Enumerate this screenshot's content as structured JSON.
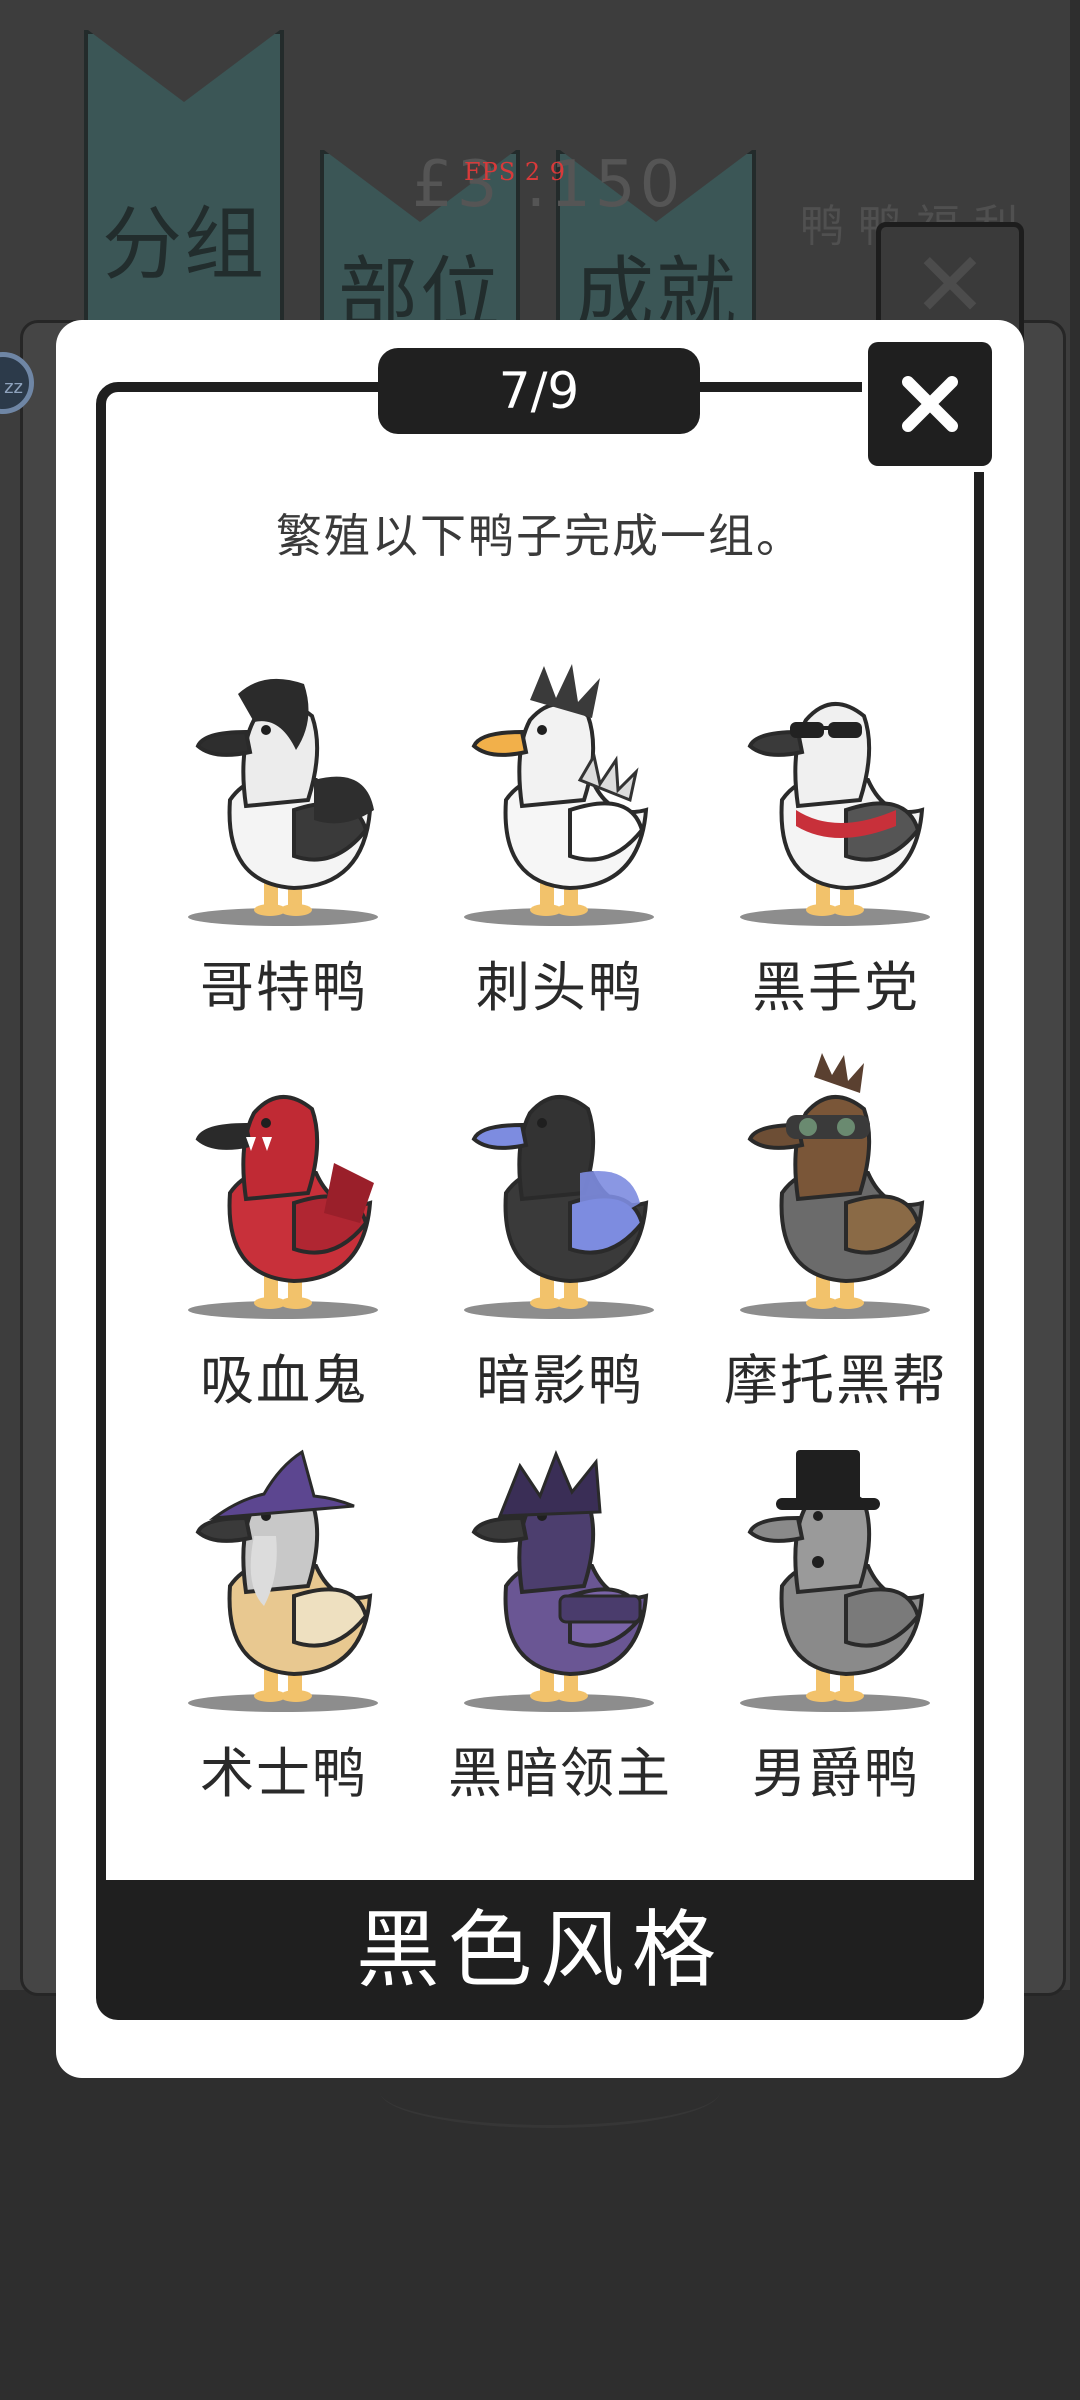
{
  "hud": {
    "fps_text": "FPS 2 9",
    "coin_text": "£3 .150"
  },
  "background": {
    "tabs": [
      {
        "label": "分组"
      },
      {
        "label": "部位"
      },
      {
        "label": "成就"
      }
    ],
    "side_label": "鸭鸭福利",
    "close_glyph": "✕",
    "side_badge": "zz"
  },
  "modal": {
    "page_indicator": "7/9",
    "instruction": "繁殖以下鸭子完成一组。",
    "ducks": [
      {
        "name": "哥特鸭",
        "icon": "goth-duck-icon",
        "body": "#f4f4f4",
        "head": "#ececec",
        "hair": "#2b2b2b",
        "wing": "#3a3a3a",
        "beak": "#2e2e2e",
        "extra": "goth"
      },
      {
        "name": "刺头鸭",
        "icon": "punk-duck-icon",
        "body": "#f6f6f6",
        "head": "#f2f2f2",
        "hair": "#3a3a3a",
        "wing": "#ffffff",
        "beak": "#f2b04a",
        "extra": "spikes"
      },
      {
        "name": "黑手党",
        "icon": "mafia-duck-icon",
        "body": "#f4f4f4",
        "head": "#f0f0f0",
        "hair": "#4a4a4a",
        "wing": "#555555",
        "beak": "#3a3a3a",
        "extra": "glasses"
      },
      {
        "name": "吸血鬼",
        "icon": "vampire-duck-icon",
        "body": "#c8303a",
        "head": "#c02a34",
        "hair": "#2a2a2a",
        "wing": "#b02632",
        "beak": "#2a2a2a",
        "extra": "vampire"
      },
      {
        "name": "暗影鸭",
        "icon": "shadow-duck-icon",
        "body": "#3a3a3a",
        "head": "#333333",
        "hair": "#2e2e2e",
        "wing": "#7d8ce0",
        "beak": "#7d8ce0",
        "extra": "shadow"
      },
      {
        "name": "摩托黑帮",
        "icon": "biker-duck-icon",
        "body": "#6b6b6b",
        "head": "#7a5638",
        "hair": "#5a4030",
        "wing": "#8a6a46",
        "beak": "#6d4e35",
        "extra": "goggles"
      },
      {
        "name": "术士鸭",
        "icon": "warlock-duck-icon",
        "body": "#e8c890",
        "head": "#c8c8c8",
        "hair": "#5c4690",
        "wing": "#eee0c0",
        "beak": "#3a3a3a",
        "extra": "wizard-hat"
      },
      {
        "name": "黑暗领主",
        "icon": "dark-lord-duck-icon",
        "body": "#6a5694",
        "head": "#4c3e6e",
        "hair": "#3a2e56",
        "wing": "#7a64a8",
        "beak": "#3a3a3a",
        "extra": "armor"
      },
      {
        "name": "男爵鸭",
        "icon": "baron-duck-icon",
        "body": "#8a8a8a",
        "head": "#9a9a9a",
        "hair": "#1f1f1f",
        "wing": "#7a7a7a",
        "beak": "#8a8a8a",
        "extra": "top-hat"
      }
    ],
    "group_title": "黑色风格"
  },
  "colors": {
    "modal_bg": "#ffffff",
    "frame": "#1f1f1f",
    "backdrop": "#2e2e2e",
    "tab_teal": "#3b5656",
    "fps_red": "#d83a3a",
    "duck_feet": "#f2c26b"
  }
}
